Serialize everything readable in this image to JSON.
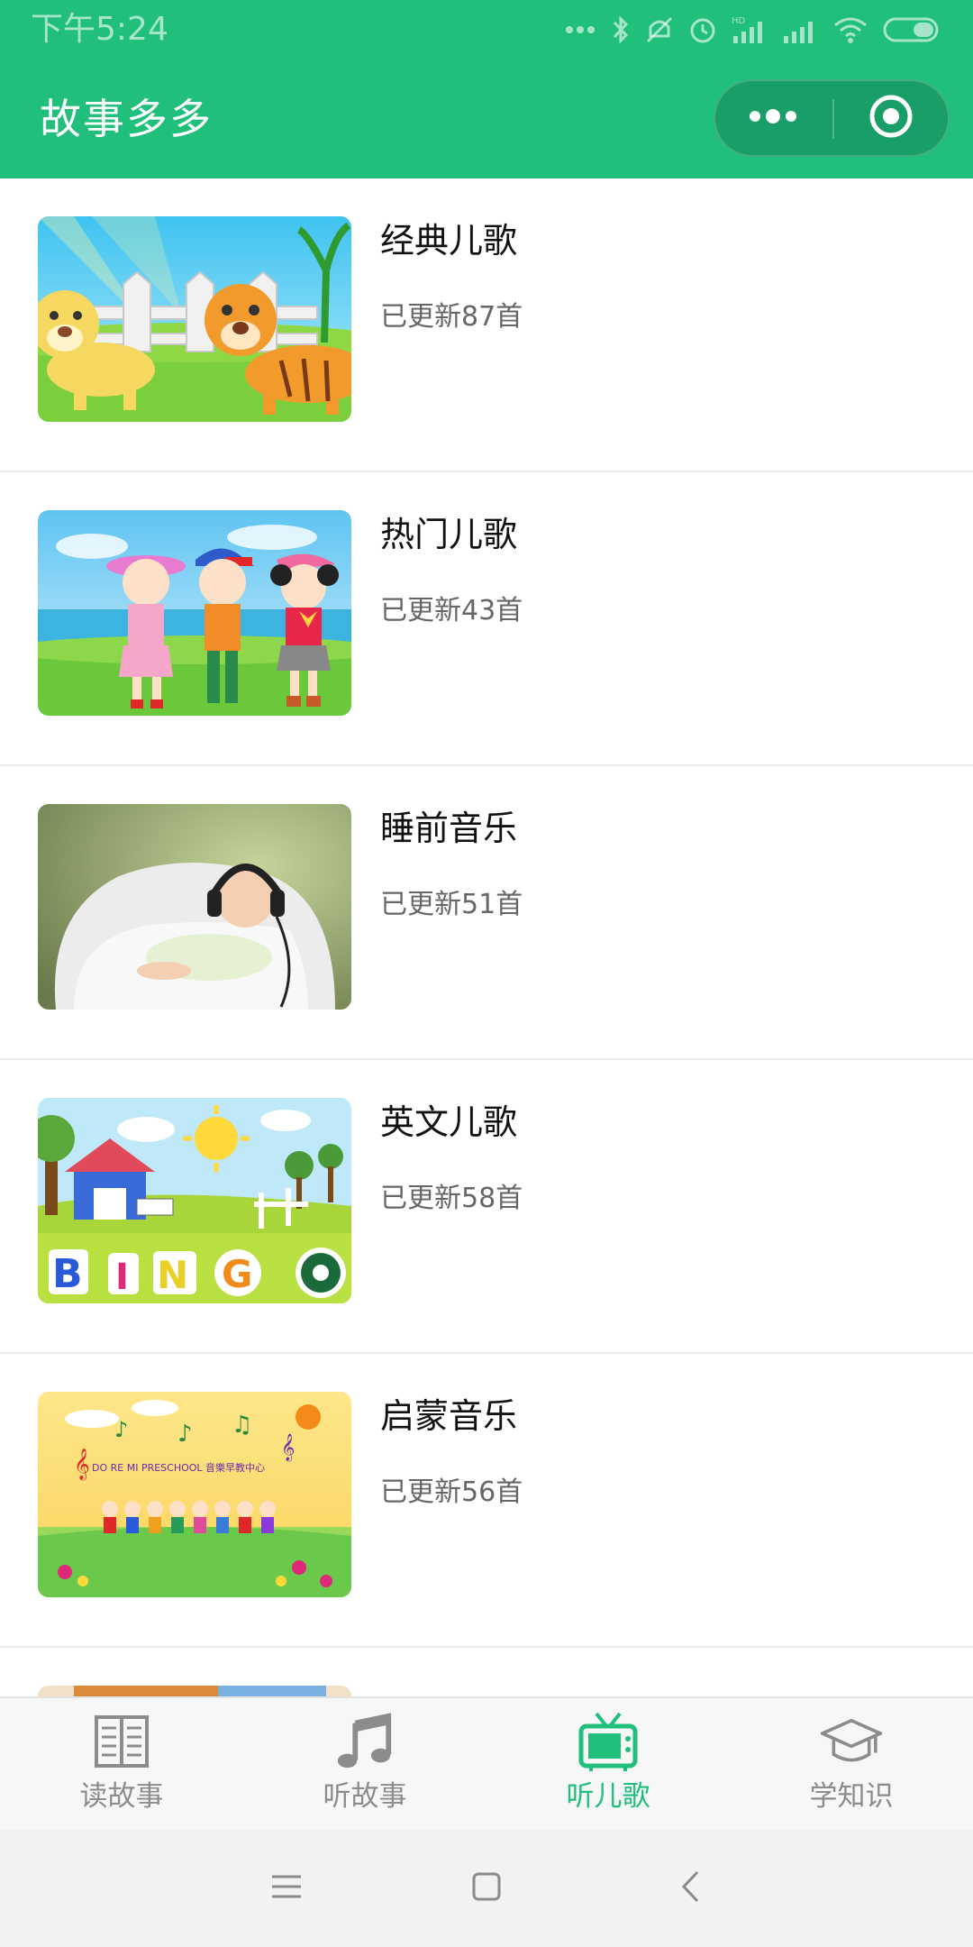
{
  "status_bar": {
    "time": "下午5:24",
    "icons": [
      "more-dots-icon",
      "bluetooth-icon",
      "mute-icon",
      "alarm-icon",
      "hd-signal-icon",
      "signal-icon",
      "wifi-icon",
      "battery-icon"
    ],
    "hd_badge": "HD"
  },
  "nav": {
    "title": "故事多多",
    "menu_icon": "more-dots-icon",
    "close_icon": "target-close-icon"
  },
  "list": {
    "items": [
      {
        "title": "经典儿歌",
        "subtitle": "已更新87首",
        "thumb": "tigers-cartoon-image"
      },
      {
        "title": "热门儿歌",
        "subtitle": "已更新43首",
        "thumb": "kids-cartoon-image"
      },
      {
        "title": "睡前音乐",
        "subtitle": "已更新51首",
        "thumb": "baby-headphones-image"
      },
      {
        "title": "英文儿歌",
        "subtitle": "已更新58首",
        "thumb": "bingo-cartoon-image"
      },
      {
        "title": "启蒙音乐",
        "subtitle": "已更新56首",
        "thumb": "preschool-music-image",
        "thumb_text": "DO RE MI PRESCHOOL 音樂早教中心"
      }
    ]
  },
  "tabbar": {
    "active": "听儿歌",
    "tabs": [
      {
        "label": "读故事",
        "icon": "book-icon"
      },
      {
        "label": "听故事",
        "icon": "music-note-icon"
      },
      {
        "label": "听儿歌",
        "icon": "tv-icon"
      },
      {
        "label": "学知识",
        "icon": "graduation-cap-icon"
      }
    ]
  },
  "system_nav": {
    "buttons": [
      "menu-lines-icon",
      "home-square-icon",
      "back-chevron-icon"
    ]
  },
  "colors": {
    "brand_green": "#21bf7c",
    "tab_inactive": "#8c8c8c",
    "text_primary": "#111111",
    "text_secondary": "#666666"
  }
}
